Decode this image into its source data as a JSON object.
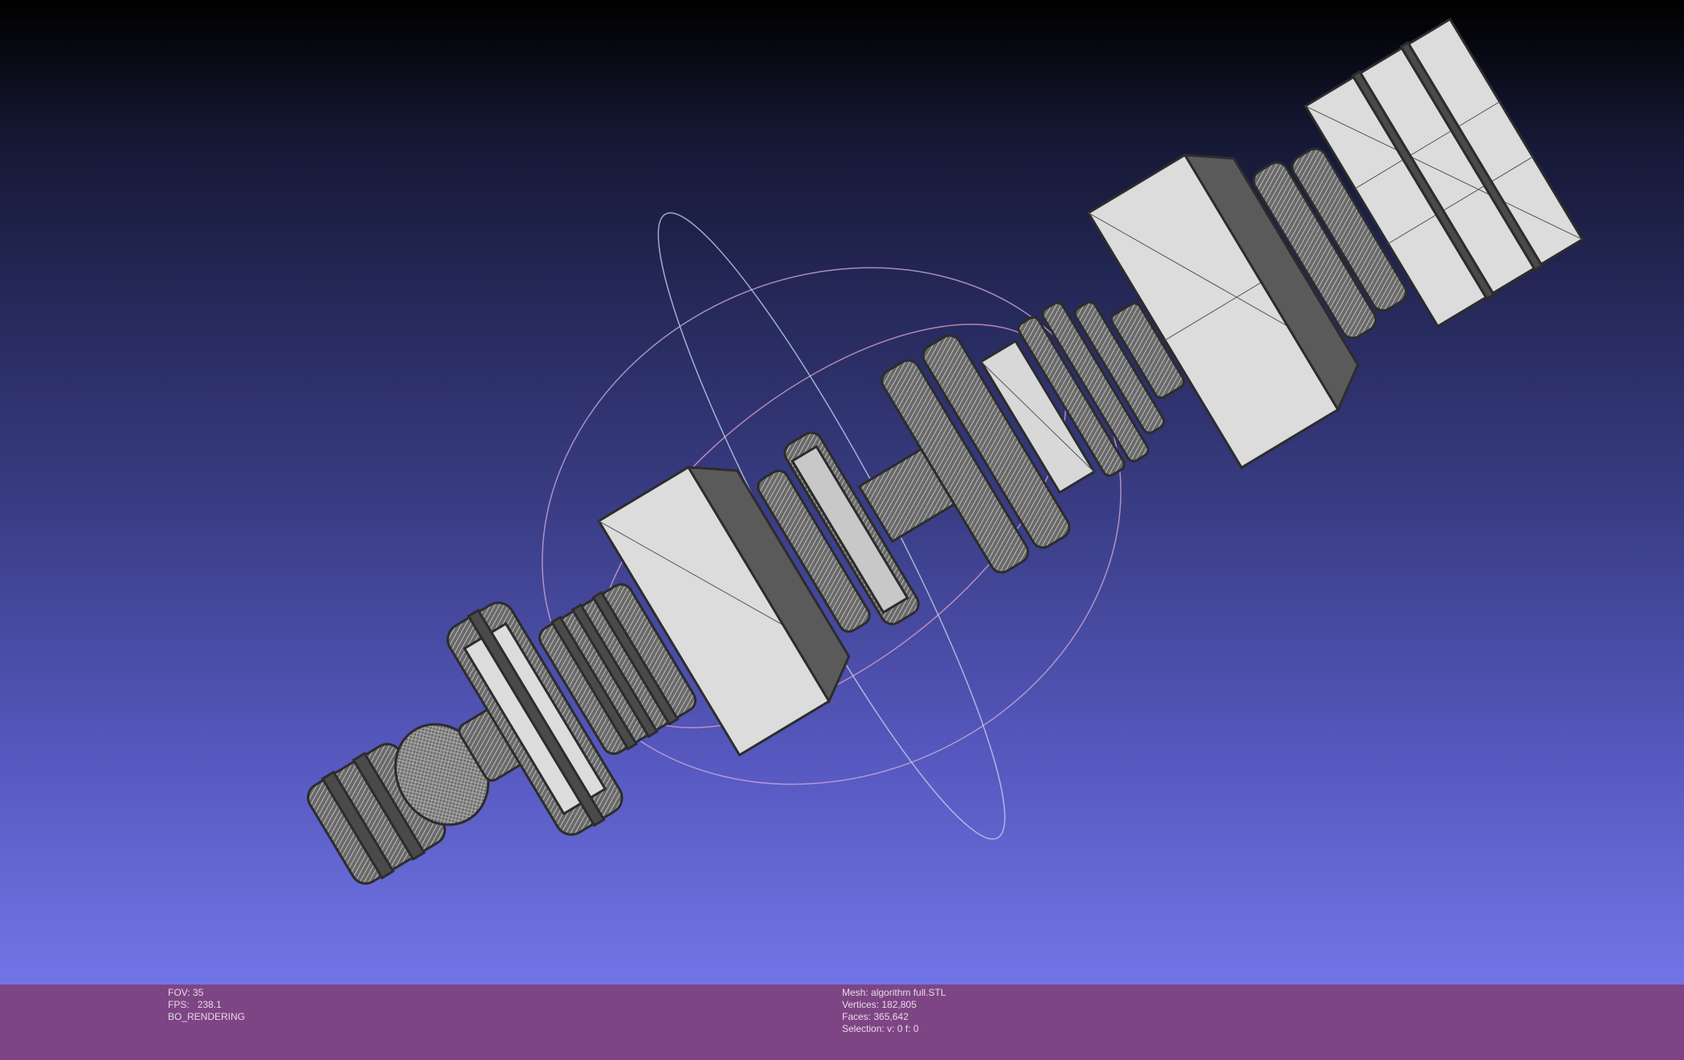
{
  "viewer": {
    "trackball": {
      "visible": true
    },
    "model": {
      "description_icon": "mesh-model-icon"
    }
  },
  "info_left": {
    "fov_label": "FOV:",
    "fov_value": "35",
    "fps_label": "FPS:",
    "fps_value": "238.1",
    "render_mode": "BO_RENDERING"
  },
  "info_right": {
    "mesh_label": "Mesh:",
    "mesh_value": "algorithm full.STL",
    "vertices_label": "Vertices:",
    "vertices_value": "182,805",
    "faces_label": "Faces:",
    "faces_value": "365,642",
    "selection_label": "Selection:",
    "selection_value": "v: 0 f: 0"
  },
  "colors": {
    "info_bar": "#7e4584",
    "mesh_light": "#dcdcdc",
    "mesh_dark": "#555555"
  }
}
